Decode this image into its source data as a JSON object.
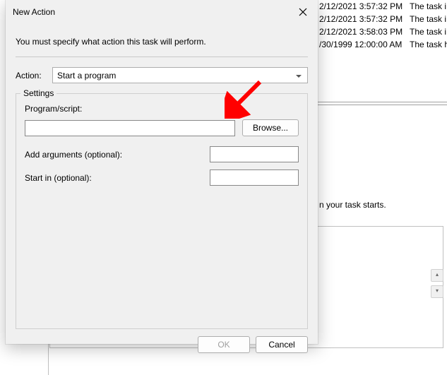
{
  "dialog": {
    "title": "New Action",
    "instruction": "You must specify what action this task will perform.",
    "action_label": "Action:",
    "action_value": "Start a program",
    "settings_legend": "Settings",
    "program_label": "Program/script:",
    "program_value": "",
    "browse_label": "Browse...",
    "arguments_label": "Add arguments (optional):",
    "arguments_value": "",
    "startin_label": "Start in (optional):",
    "startin_value": "",
    "ok_label": "OK",
    "cancel_label": "Cancel"
  },
  "background": {
    "rows": [
      {
        "date": "2/12/2021 3:57:32 PM",
        "desc": "The task i"
      },
      {
        "date": "2/12/2021 3:57:32 PM",
        "desc": "The task i"
      },
      {
        "date": "2/12/2021 3:58:03 PM",
        "desc": "The task i"
      },
      {
        "date": "/30/1999 12:00:00 AM",
        "desc": "The task h"
      }
    ],
    "hint_text": "n your task starts.",
    "scroll_up": "▴",
    "scroll_down": "▾"
  }
}
